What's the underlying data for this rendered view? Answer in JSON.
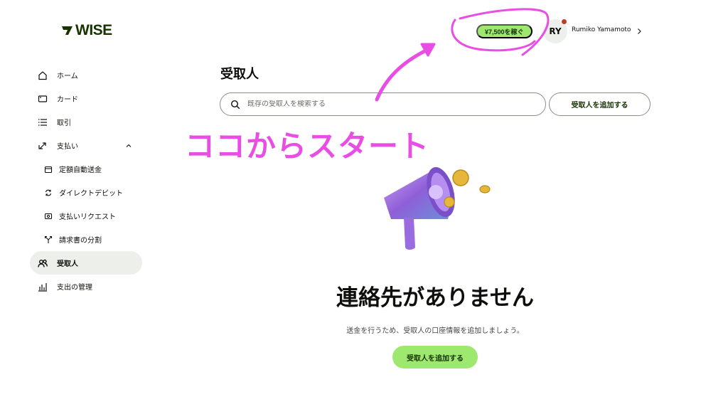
{
  "brand": {
    "logo_text": "WISE",
    "logo_color": "#163300",
    "accent": "#9fe870"
  },
  "sidebar": {
    "items": [
      {
        "label": "ホーム",
        "icon": "home-icon"
      },
      {
        "label": "カード",
        "icon": "card-icon"
      },
      {
        "label": "取引",
        "icon": "list-icon"
      },
      {
        "label": "支払い",
        "icon": "transfer-icon",
        "expanded": true
      },
      {
        "label": "定額自動送金",
        "icon": "calendar-icon"
      },
      {
        "label": "ダイレクトデビット",
        "icon": "refresh-icon"
      },
      {
        "label": "支払いリクエスト",
        "icon": "request-icon"
      },
      {
        "label": "請求書の分割",
        "icon": "split-icon"
      },
      {
        "label": "受取人",
        "icon": "recipients-icon",
        "active": true
      },
      {
        "label": "支出の管理",
        "icon": "chart-icon"
      }
    ]
  },
  "header": {
    "earn_label": "¥7,500を稼ぐ",
    "avatar_initials": "RY",
    "user_name": "Rumiko Yamamoto"
  },
  "main": {
    "title": "受取人",
    "search_placeholder": "既存の受取人を検索する",
    "add_recipient_label": "受取人を追加する",
    "empty_title": "連絡先がありません",
    "empty_description": "送金を行うため、受取人の口座情報を追加しましょう。",
    "empty_button_label": "受取人を追加する"
  },
  "annotation": {
    "text": "ココからスタート",
    "color": "#e94ee4"
  }
}
